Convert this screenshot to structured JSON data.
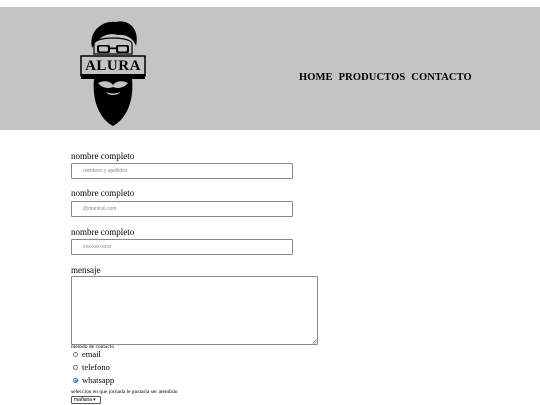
{
  "header": {
    "logo_text": "ALURA",
    "nav": [
      "HOME",
      "PRODUCTOS",
      "CONTACTO"
    ],
    "background": "#c4c4c4"
  },
  "form": {
    "fields": [
      {
        "label": "nombre completo",
        "placeholder": "nombres y apellidos"
      },
      {
        "label": "nombre completo",
        "placeholder": "@dominio.com"
      },
      {
        "label": "nombre completo",
        "placeholder": "xxx-xxx-xxxx"
      }
    ],
    "message_label": "mensaje",
    "contact_method_label": "metodo de contacto",
    "contact_options": [
      {
        "label": "email",
        "checked": false
      },
      {
        "label": "telefono",
        "checked": false
      },
      {
        "label": "whatsapp",
        "checked": true
      }
    ],
    "schedule_label": "seleccion en que jornada le gustaria ser atendido",
    "schedule_selected": "mañana",
    "accent": "#1a73e8"
  }
}
